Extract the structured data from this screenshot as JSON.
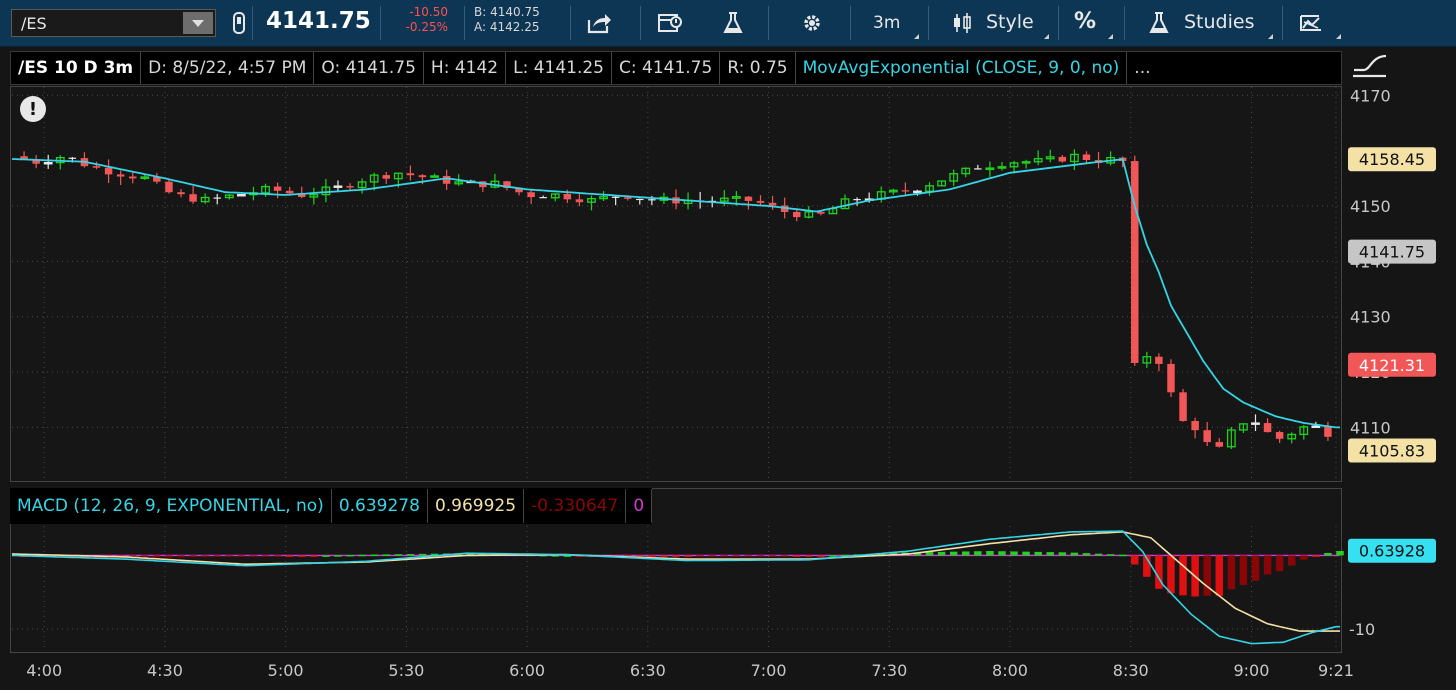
{
  "toolbar": {
    "symbol": "/ES",
    "last_price": "4141.75",
    "net_change": "-10.50",
    "net_change_pct": "-0.25%",
    "bid": "B: 4140.75",
    "ask": "A: 4142.25",
    "timeframe": "3m",
    "style_label": "Style",
    "percent_label": "%",
    "studies_label": "Studies"
  },
  "header": {
    "title": "/ES 10 D 3m",
    "date": "D: 8/5/22, 4:57 PM",
    "open": "O: 4141.75",
    "high": "H: 4142",
    "low": "L: 4141.25",
    "close": "C: 4141.75",
    "range": "R: 0.75",
    "study": "MovAvgExponential (CLOSE, 9, 0, no)",
    "more": "..."
  },
  "price_axis": {
    "ticks": [
      "4170",
      "4150",
      "4140",
      "4130",
      "4120",
      "4110"
    ],
    "tick_values": [
      4170,
      4150,
      4140,
      4130,
      4120,
      4110
    ],
    "range": [
      4100.5,
      4171.5
    ],
    "bubbles": [
      {
        "label": "4158.45",
        "value": 4158.45,
        "bg": "#f3e1a6",
        "fg": "#111111"
      },
      {
        "label": "4141.75",
        "value": 4141.75,
        "bg": "#c6c6c6",
        "fg": "#111111"
      },
      {
        "label": "4121.31",
        "value": 4121.31,
        "bg": "#f25757",
        "fg": "#ffffff"
      },
      {
        "label": "4105.83",
        "value": 4105.83,
        "bg": "#f3e1a6",
        "fg": "#111111"
      }
    ]
  },
  "macd": {
    "title": "MACD (12, 26, 9, EXPONENTIAL, no)",
    "value": "0.639278",
    "avg": "0.969925",
    "diff": "-0.330647",
    "zero": "0",
    "axis_ticks": [
      "-10"
    ],
    "axis_values": [
      -10
    ],
    "range": [
      -13,
      4
    ],
    "bubble": {
      "label": "0.63928",
      "value": 0.63928,
      "bg": "#35e0f0",
      "fg": "#111111"
    }
  },
  "time_axis": {
    "labels": [
      "4:00",
      "4:30",
      "5:00",
      "5:30",
      "6:00",
      "6:30",
      "7:00",
      "7:30",
      "8:00",
      "8:30",
      "9:00",
      "9:21"
    ],
    "minutes": [
      240,
      270,
      300,
      330,
      360,
      390,
      420,
      450,
      480,
      510,
      540,
      561
    ]
  },
  "colors": {
    "up": "#1fd31f",
    "down": "#f25757",
    "ema": "#35d5e6",
    "macd_value": "#35d5e6",
    "macd_avg": "#f3e1a6",
    "zero_line": "#d43ad4",
    "hist_up": "#1fd31f",
    "hist_down": "#e01010",
    "hist_down_dark": "#8a0505"
  },
  "chart_data": {
    "type": "candlestick",
    "x_unit": "clock minutes",
    "x_range": [
      232,
      562
    ],
    "price_anchors": [
      [
        232,
        4159
      ],
      [
        238,
        4158
      ],
      [
        245,
        4159
      ],
      [
        252,
        4157
      ],
      [
        258,
        4156
      ],
      [
        265,
        4155
      ],
      [
        272,
        4152
      ],
      [
        280,
        4151
      ],
      [
        288,
        4152
      ],
      [
        296,
        4153
      ],
      [
        304,
        4152
      ],
      [
        312,
        4153
      ],
      [
        320,
        4155
      ],
      [
        328,
        4156
      ],
      [
        336,
        4155
      ],
      [
        344,
        4154
      ],
      [
        352,
        4154
      ],
      [
        360,
        4152
      ],
      [
        368,
        4152
      ],
      [
        376,
        4151
      ],
      [
        384,
        4152
      ],
      [
        392,
        4151
      ],
      [
        400,
        4151
      ],
      [
        408,
        4151
      ],
      [
        416,
        4151
      ],
      [
        424,
        4149
      ],
      [
        432,
        4148
      ],
      [
        440,
        4151
      ],
      [
        448,
        4152
      ],
      [
        456,
        4153
      ],
      [
        464,
        4155
      ],
      [
        472,
        4157
      ],
      [
        480,
        4158
      ],
      [
        488,
        4158
      ],
      [
        496,
        4159
      ],
      [
        504,
        4158
      ],
      [
        507,
        4159
      ],
      [
        508,
        4158
      ],
      [
        508.5,
        4137
      ],
      [
        509.3,
        4120
      ],
      [
        511,
        4121
      ],
      [
        514,
        4123
      ],
      [
        517,
        4122
      ],
      [
        520,
        4116
      ],
      [
        523,
        4111
      ],
      [
        526,
        4110
      ],
      [
        529,
        4107
      ],
      [
        532,
        4106
      ],
      [
        535,
        4109
      ],
      [
        538,
        4111
      ],
      [
        541,
        4111
      ],
      [
        544,
        4109
      ],
      [
        547,
        4108
      ],
      [
        550,
        4109
      ],
      [
        553,
        4110
      ],
      [
        556,
        4110
      ],
      [
        559,
        4109
      ],
      [
        561,
        4108.5
      ]
    ],
    "ema_anchors": [
      [
        232,
        4158.5
      ],
      [
        250,
        4158
      ],
      [
        270,
        4155
      ],
      [
        285,
        4152.5
      ],
      [
        300,
        4152
      ],
      [
        320,
        4153
      ],
      [
        340,
        4155
      ],
      [
        360,
        4153
      ],
      [
        380,
        4152
      ],
      [
        400,
        4151
      ],
      [
        420,
        4150
      ],
      [
        432,
        4149
      ],
      [
        445,
        4151
      ],
      [
        465,
        4153
      ],
      [
        480,
        4156
      ],
      [
        500,
        4157.8
      ],
      [
        508,
        4158.45
      ],
      [
        511,
        4150
      ],
      [
        514,
        4143
      ],
      [
        517,
        4138
      ],
      [
        520,
        4132
      ],
      [
        524,
        4127
      ],
      [
        528,
        4122
      ],
      [
        533,
        4117
      ],
      [
        538,
        4114.5
      ],
      [
        546,
        4112
      ],
      [
        553,
        4110.8
      ],
      [
        561,
        4110
      ]
    ],
    "macd_value_anchors": [
      [
        232,
        0
      ],
      [
        260,
        -0.5
      ],
      [
        290,
        -1.4
      ],
      [
        320,
        -0.8
      ],
      [
        345,
        0.3
      ],
      [
        370,
        0.1
      ],
      [
        400,
        -0.7
      ],
      [
        430,
        -0.6
      ],
      [
        455,
        0.6
      ],
      [
        475,
        2.2
      ],
      [
        495,
        3.2
      ],
      [
        508,
        3.3
      ],
      [
        513,
        0.5
      ],
      [
        518,
        -4
      ],
      [
        525,
        -8
      ],
      [
        532,
        -11
      ],
      [
        540,
        -12
      ],
      [
        548,
        -11.8
      ],
      [
        555,
        -10.5
      ],
      [
        561,
        -9.7
      ]
    ],
    "macd_avg_anchors": [
      [
        232,
        0.2
      ],
      [
        260,
        -0.2
      ],
      [
        290,
        -1.2
      ],
      [
        320,
        -0.9
      ],
      [
        345,
        0
      ],
      [
        370,
        0.1
      ],
      [
        400,
        -0.5
      ],
      [
        430,
        -0.5
      ],
      [
        455,
        0.2
      ],
      [
        475,
        1.6
      ],
      [
        495,
        2.8
      ],
      [
        508,
        3.2
      ],
      [
        515,
        2.4
      ],
      [
        520,
        0
      ],
      [
        528,
        -3.8
      ],
      [
        536,
        -7.2
      ],
      [
        544,
        -9.3
      ],
      [
        552,
        -10.3
      ],
      [
        561,
        -10.3
      ]
    ]
  }
}
